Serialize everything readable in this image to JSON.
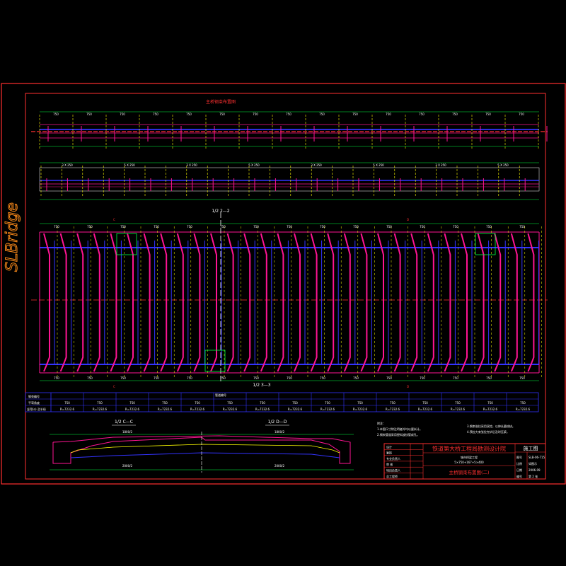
{
  "watermark": "SLBridge",
  "plan_title": "主桥钢束布置图",
  "section_labels": {
    "top_section": "1/2  2—2",
    "bottom_section": "1/2  3—3",
    "section_c": "1/2  C—C",
    "section_d": "1/2  D—D",
    "cut_c": "C",
    "cut_d": "D"
  },
  "dimensions": {
    "span": "750",
    "span_alt": "1000",
    "web_detail": "3 X 250",
    "web_detail_b": "5 X 250",
    "half_width": "2000/2",
    "deck_width": "1800/2",
    "depth": "400"
  },
  "table": {
    "header_label": "钢束编号",
    "row1_label": "平弯角度",
    "row2_label": "竖弯(o) 及半径",
    "middle_header": "管道编号",
    "span_label": "750",
    "curve_label": "R=7232.6"
  },
  "notes": {
    "title": "附注：",
    "left": [
      "1.本图尺寸除注明者外均以厘米计。",
      "2.钢束管道采用塑料波纹管成孔。"
    ],
    "right": [
      "3.钢束张拉采用双控，以伸长量校核。",
      "4.预应力束张拉完毕后及时压浆。"
    ]
  },
  "title_block": {
    "company": "铁道第大桥工程局勘测设计院",
    "project_line1": "城市桥梁工程",
    "project_line2": "5×750+167+5×400",
    "drawing_title": "主桥钢束布置图(二)",
    "stage": "施工图",
    "fields_left": [
      "设计",
      "复核",
      "专业负责人",
      "审 核",
      "项目负责人",
      "总工程师"
    ],
    "fields_right_labels": [
      "图号",
      "比例",
      "日期",
      "编号"
    ],
    "fields_right_values": [
      "SLB-06-715",
      "如图示",
      "2006.09",
      "第 2 张"
    ]
  },
  "colors": {
    "frame": "#ff3030",
    "rebar": "#ff1493",
    "tendon": "#3333ff",
    "guide": "#ffff00",
    "dim": "#00ff40",
    "text": "#ffffff",
    "section": "#00ffff"
  }
}
